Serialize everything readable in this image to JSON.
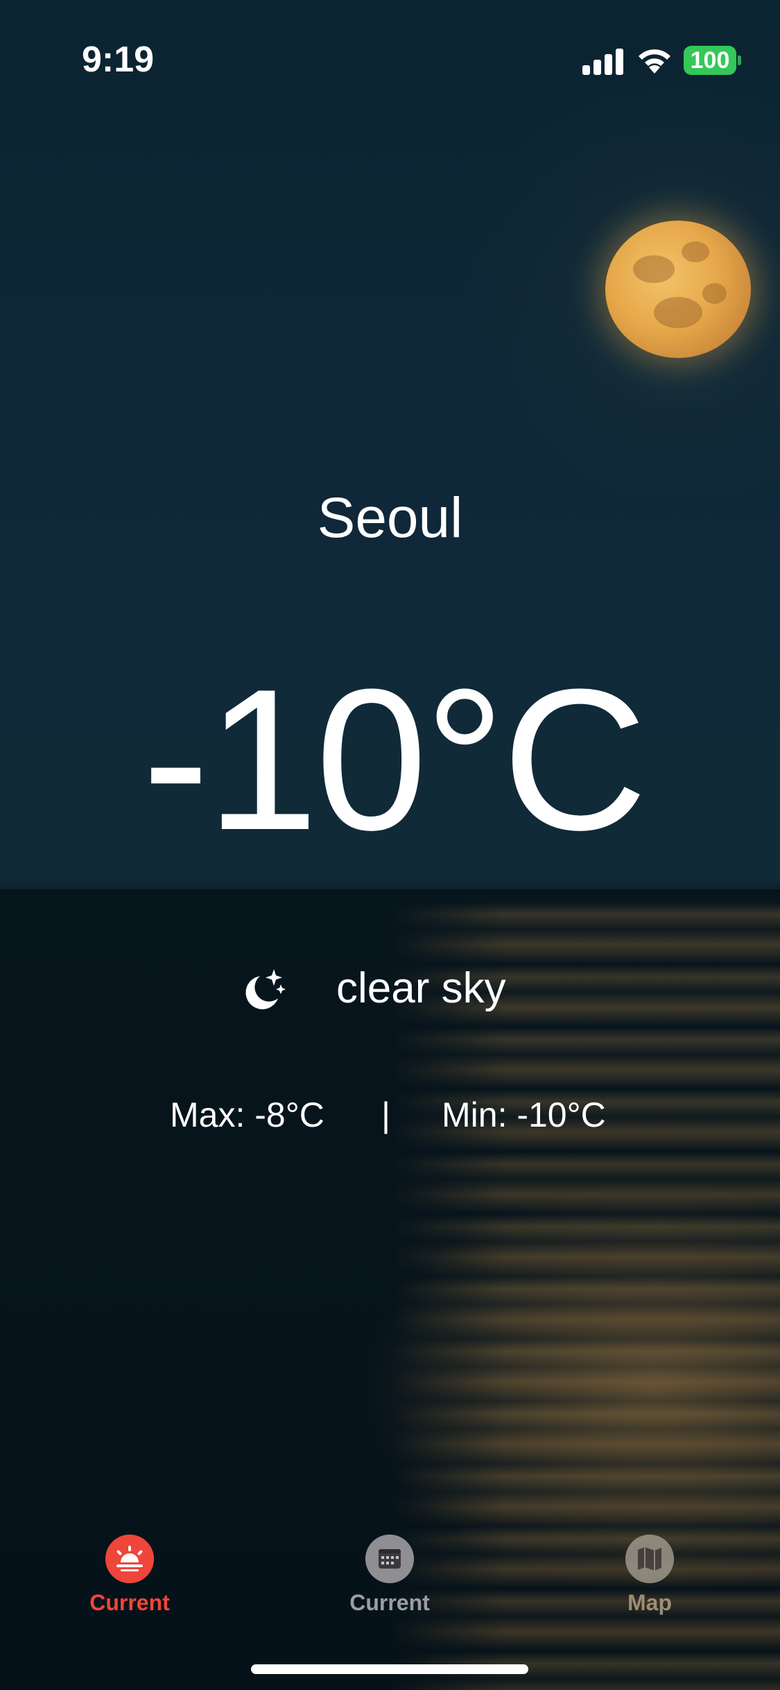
{
  "status_bar": {
    "time": "9:19",
    "battery": "100",
    "signal_icon": "cellular-signal-icon",
    "wifi_icon": "wifi-icon",
    "battery_color": "#34c759"
  },
  "weather": {
    "city": "Seoul",
    "temperature": "-10°C",
    "condition_icon": "moon-stars-icon",
    "condition": "clear sky",
    "max": "Max: -8°C",
    "separator": "|",
    "min": "Min: -10°C"
  },
  "tab_bar": {
    "tabs": [
      {
        "label": "Current",
        "icon": "sunset-icon",
        "active": true,
        "color": "#f0453a"
      },
      {
        "label": "Current",
        "icon": "calendar-icon",
        "active": false,
        "color": "#8e8e93"
      },
      {
        "label": "Map",
        "icon": "map-icon",
        "active": false,
        "color": "#8e8e93"
      }
    ]
  }
}
